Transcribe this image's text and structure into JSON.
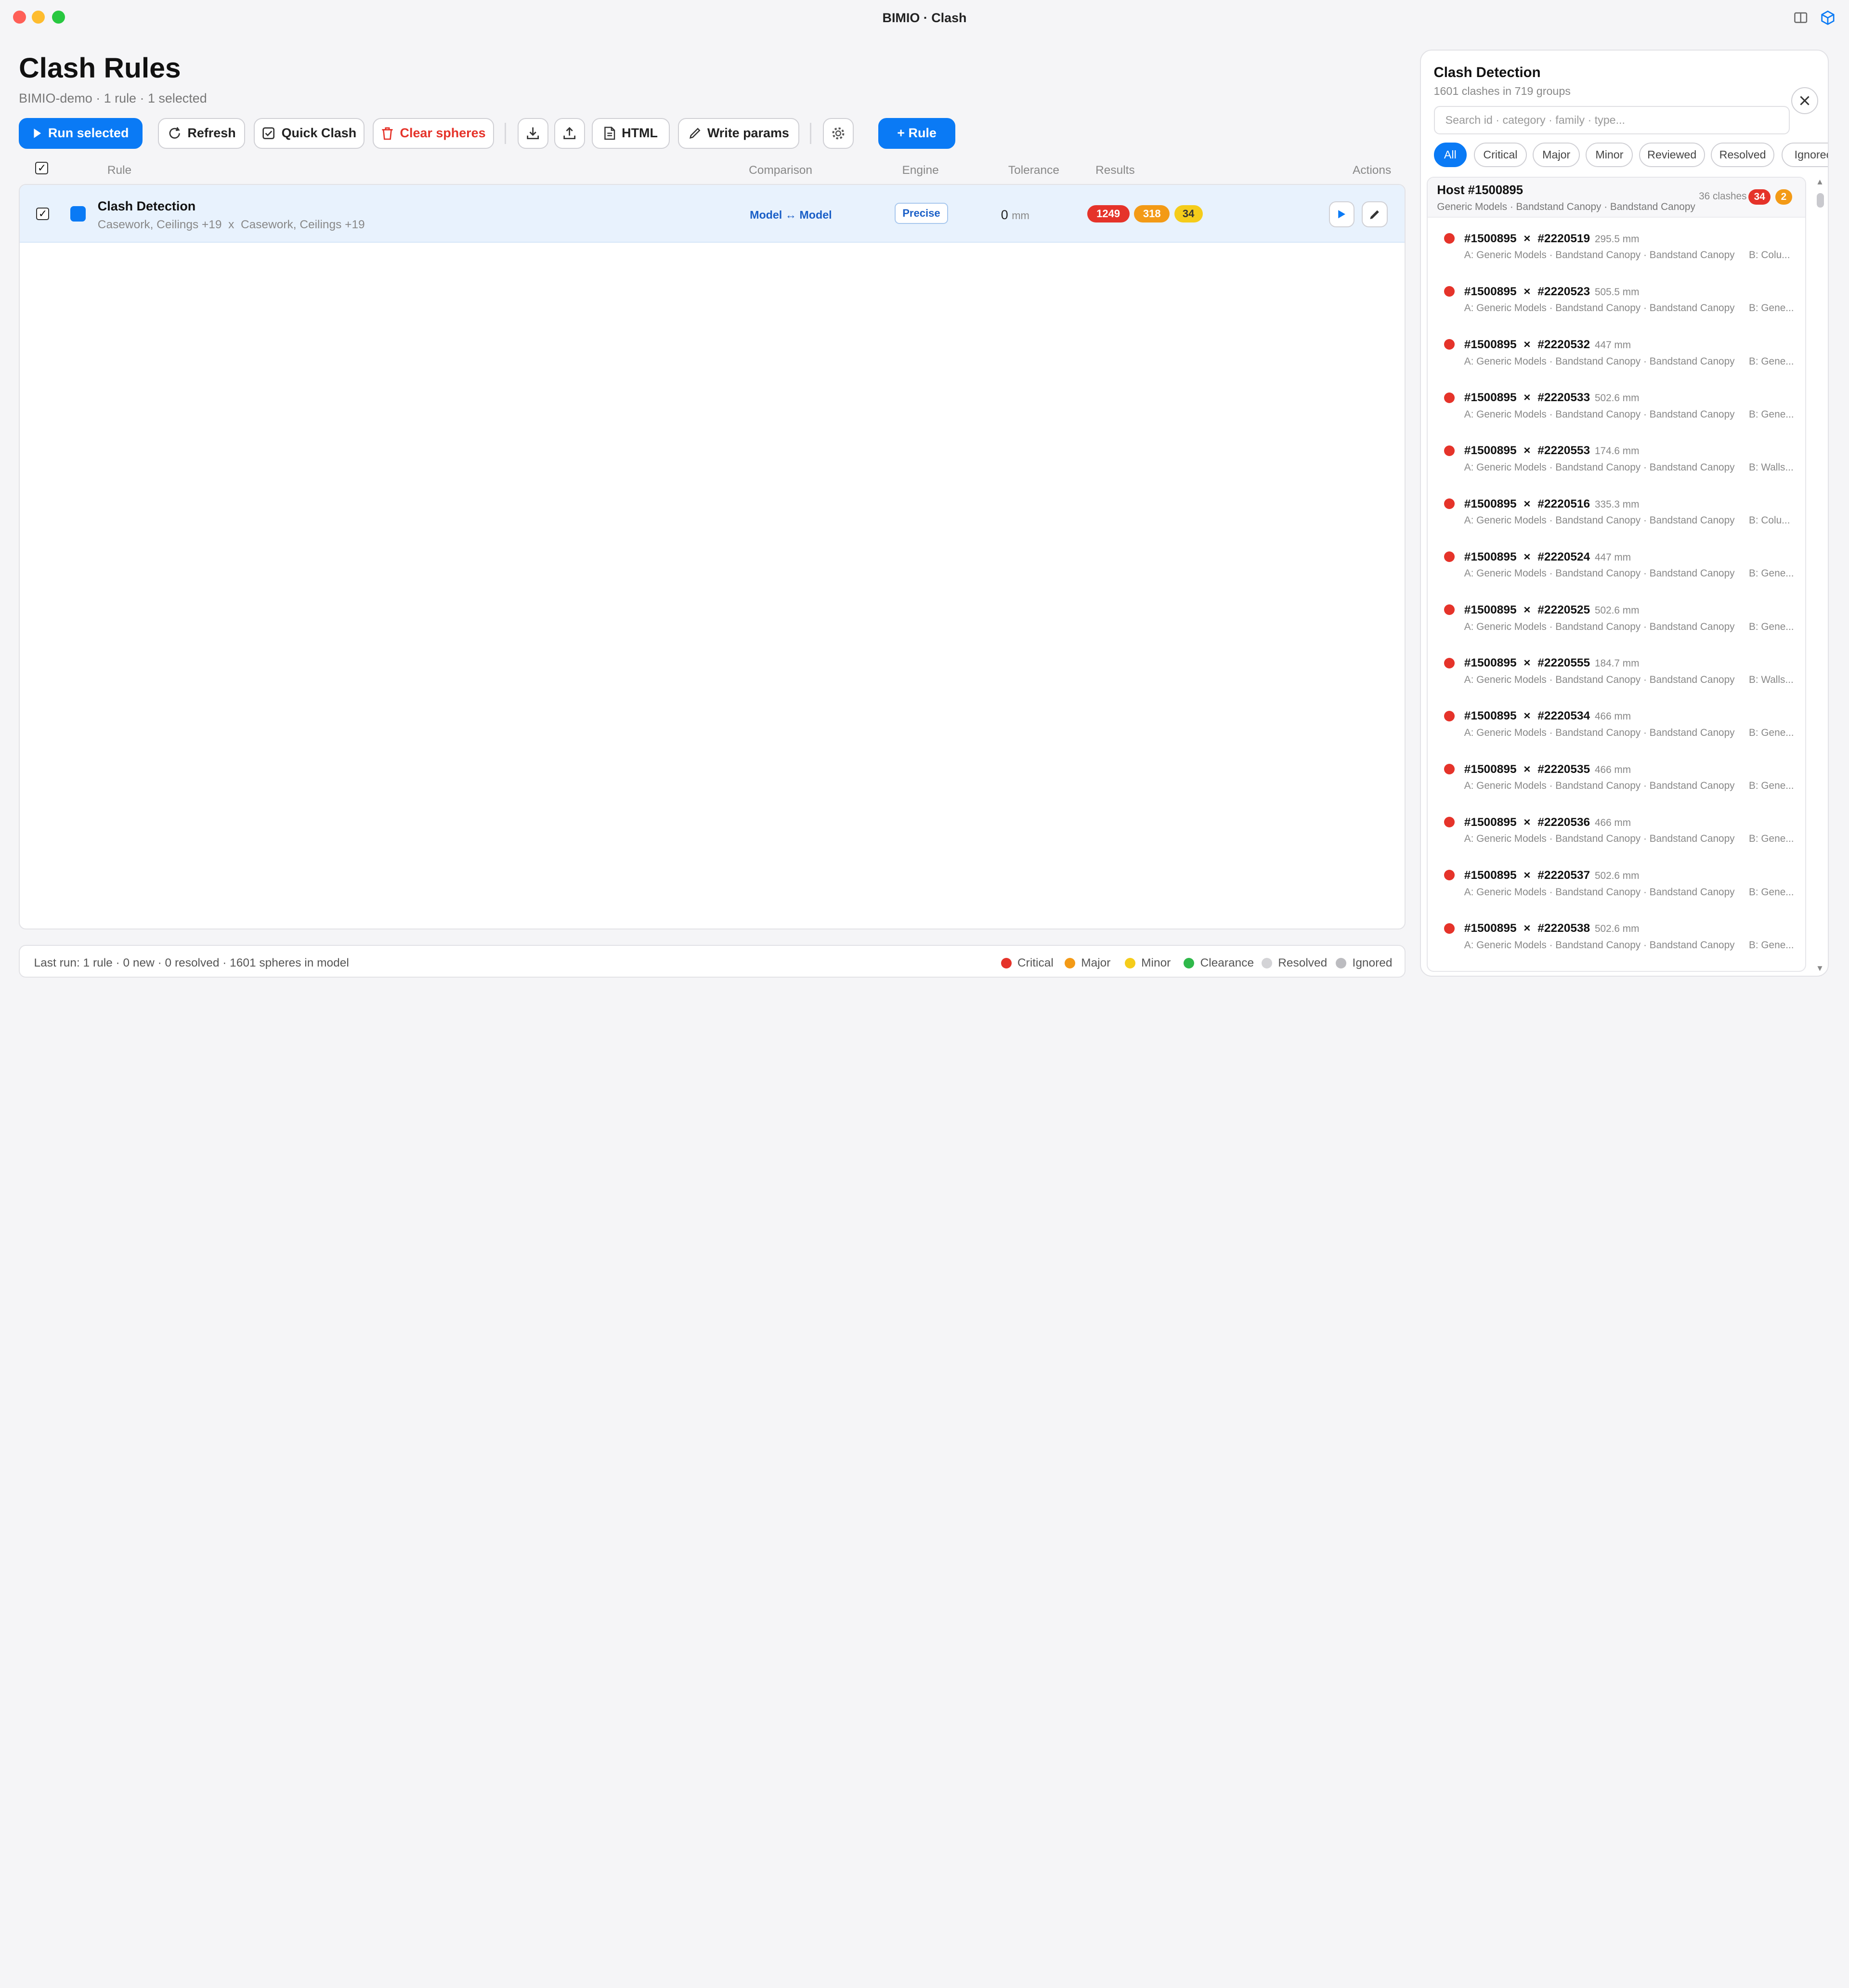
{
  "window": {
    "title": "BIMIO · Clash"
  },
  "page": {
    "title": "Clash Rules",
    "subtitle": "BIMIO-demo · 1 rule · 1 selected"
  },
  "toolbar": {
    "run_selected": "Run selected",
    "refresh": "Refresh",
    "quick_clash": "Quick Clash",
    "clear_spheres": "Clear spheres",
    "html": "HTML",
    "write_params": "Write params",
    "add_rule": "+ Rule"
  },
  "table": {
    "headers": {
      "rule": "Rule",
      "comparison": "Comparison",
      "engine": "Engine",
      "tolerance": "Tolerance",
      "results": "Results",
      "actions": "Actions"
    },
    "rows": [
      {
        "name": "Clash Detection",
        "categories": "Casework, Ceilings +19  x  Casework, Ceilings +19",
        "comparison": "Model ↔ Model",
        "engine": "Precise",
        "tolerance_value": "0",
        "tolerance_unit": "mm",
        "results": {
          "critical": "1249",
          "major": "318",
          "minor": "34"
        }
      }
    ]
  },
  "footer": {
    "status": "Last run: 1 rule · 0 new · 0 resolved · 1601 spheres in model",
    "legend": [
      "Critical",
      "Major",
      "Minor",
      "Clearance",
      "Resolved",
      "Ignored"
    ]
  },
  "colors": {
    "accent": "#0a7af5",
    "critical": "#e5332a",
    "major": "#f39a16",
    "minor": "#f5cc1a",
    "clearance": "#2fb84a",
    "resolved": "#d3d3d6",
    "ignored": "#bcbcc0"
  },
  "side": {
    "title": "Clash Detection",
    "subtitle": "1601 clashes in 719 groups",
    "search_placeholder": "Search id · category · family · type...",
    "filters": [
      "All",
      "Critical",
      "Major",
      "Minor",
      "Reviewed",
      "Resolved",
      "Ignored"
    ],
    "host": {
      "title": "Host #1500895",
      "subtitle": "Generic Models · Bandstand Canopy · Bandstand Canopy",
      "count": "36 clashes",
      "critical": "34",
      "major": "2"
    },
    "clashes": [
      {
        "a": "#1500895",
        "b": "#2220519",
        "dist": "295.5 mm",
        "a_desc": "A: Generic Models · Bandstand Canopy · Bandstand Canopy",
        "b_desc": "B: Colu..."
      },
      {
        "a": "#1500895",
        "b": "#2220523",
        "dist": "505.5 mm",
        "a_desc": "A: Generic Models · Bandstand Canopy · Bandstand Canopy",
        "b_desc": "B: Gene..."
      },
      {
        "a": "#1500895",
        "b": "#2220532",
        "dist": "447 mm",
        "a_desc": "A: Generic Models · Bandstand Canopy · Bandstand Canopy",
        "b_desc": "B: Gene..."
      },
      {
        "a": "#1500895",
        "b": "#2220533",
        "dist": "502.6 mm",
        "a_desc": "A: Generic Models · Bandstand Canopy · Bandstand Canopy",
        "b_desc": "B: Gene..."
      },
      {
        "a": "#1500895",
        "b": "#2220553",
        "dist": "174.6 mm",
        "a_desc": "A: Generic Models · Bandstand Canopy · Bandstand Canopy",
        "b_desc": "B: Walls..."
      },
      {
        "a": "#1500895",
        "b": "#2220516",
        "dist": "335.3 mm",
        "a_desc": "A: Generic Models · Bandstand Canopy · Bandstand Canopy",
        "b_desc": "B: Colu..."
      },
      {
        "a": "#1500895",
        "b": "#2220524",
        "dist": "447 mm",
        "a_desc": "A: Generic Models · Bandstand Canopy · Bandstand Canopy",
        "b_desc": "B: Gene..."
      },
      {
        "a": "#1500895",
        "b": "#2220525",
        "dist": "502.6 mm",
        "a_desc": "A: Generic Models · Bandstand Canopy · Bandstand Canopy",
        "b_desc": "B: Gene..."
      },
      {
        "a": "#1500895",
        "b": "#2220555",
        "dist": "184.7 mm",
        "a_desc": "A: Generic Models · Bandstand Canopy · Bandstand Canopy",
        "b_desc": "B: Walls..."
      },
      {
        "a": "#1500895",
        "b": "#2220534",
        "dist": "466 mm",
        "a_desc": "A: Generic Models · Bandstand Canopy · Bandstand Canopy",
        "b_desc": "B: Gene..."
      },
      {
        "a": "#1500895",
        "b": "#2220535",
        "dist": "466 mm",
        "a_desc": "A: Generic Models · Bandstand Canopy · Bandstand Canopy",
        "b_desc": "B: Gene..."
      },
      {
        "a": "#1500895",
        "b": "#2220536",
        "dist": "466 mm",
        "a_desc": "A: Generic Models · Bandstand Canopy · Bandstand Canopy",
        "b_desc": "B: Gene..."
      },
      {
        "a": "#1500895",
        "b": "#2220537",
        "dist": "502.6 mm",
        "a_desc": "A: Generic Models · Bandstand Canopy · Bandstand Canopy",
        "b_desc": "B: Gene..."
      },
      {
        "a": "#1500895",
        "b": "#2220538",
        "dist": "502.6 mm",
        "a_desc": "A: Generic Models · Bandstand Canopy · Bandstand Canopy",
        "b_desc": "B: Gene..."
      }
    ]
  }
}
